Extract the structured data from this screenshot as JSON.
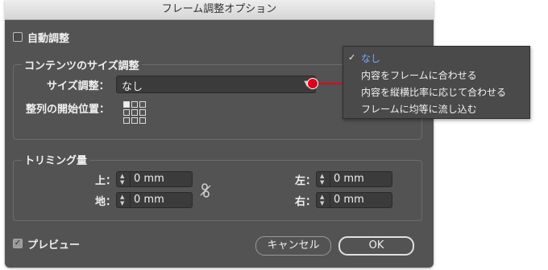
{
  "window": {
    "title": "フレーム調整オプション"
  },
  "auto_fit": {
    "label": "自動調整",
    "checked": false
  },
  "content_fitting": {
    "legend": "コンテンツのサイズ調整",
    "fitting_label": "サイズ調整：",
    "fitting_value": "なし",
    "align_label": "整列の開始位置：",
    "reference_point": "top-left"
  },
  "fitting_menu": {
    "items": [
      {
        "label": "なし",
        "selected": true
      },
      {
        "label": "内容をフレームに合わせる",
        "selected": false
      },
      {
        "label": "内容を縦横比率に応じて合わせる",
        "selected": false
      },
      {
        "label": "フレームに均等に流し込む",
        "selected": false
      }
    ],
    "check_icon": "checkmark-icon"
  },
  "crop": {
    "legend": "トリミング量",
    "top_label": "上：",
    "top_value": "0 mm",
    "bottom_label": "地：",
    "bottom_value": "0 mm",
    "left_label": "左：",
    "left_value": "0 mm",
    "right_label": "右：",
    "right_value": "0 mm",
    "link_icon": "link-broken-icon"
  },
  "preview": {
    "label": "プレビュー",
    "checked": true
  },
  "buttons": {
    "cancel": "キャンセル",
    "ok": "OK"
  },
  "annotation_color": "#e0001b",
  "accent_color": "#79a8ff"
}
